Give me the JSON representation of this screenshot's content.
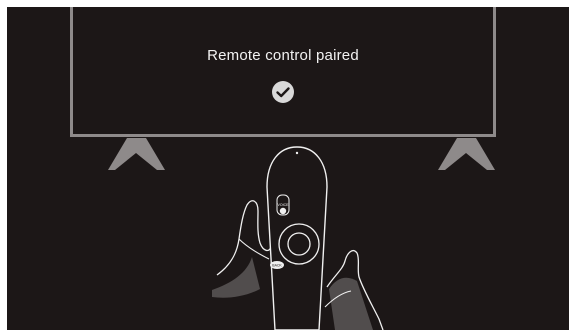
{
  "pairing": {
    "message": "Remote control paired",
    "status_icon": "check-circle-icon"
  },
  "remote": {
    "mic_button_label": "VOICE",
    "back_button_label": "BACK"
  },
  "colors": {
    "background": "#1c1717",
    "tv_frame": "#8e8a8a",
    "line_art": "#f0f0f0",
    "check_circle": "#d9d9d9"
  }
}
